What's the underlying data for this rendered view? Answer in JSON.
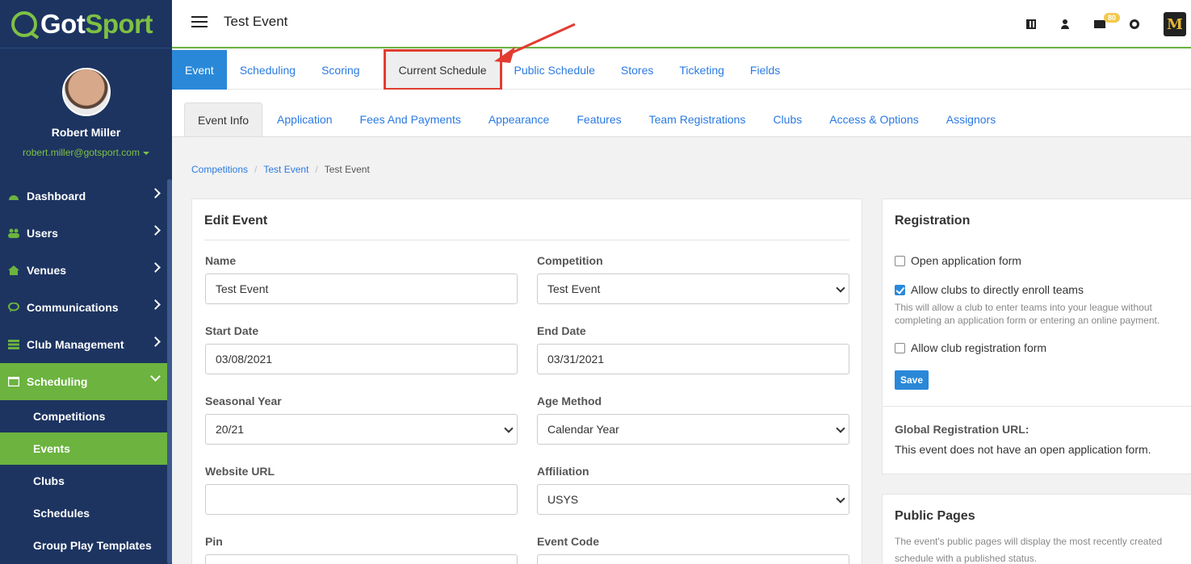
{
  "brand": {
    "name_a": "Got",
    "name_b": "Sport"
  },
  "profile": {
    "name": "Robert Miller",
    "email": "robert.miller@gotsport.com"
  },
  "sidebar": {
    "items": [
      {
        "label": "Dashboard"
      },
      {
        "label": "Users"
      },
      {
        "label": "Venues"
      },
      {
        "label": "Communications"
      },
      {
        "label": "Club Management"
      },
      {
        "label": "Scheduling"
      }
    ],
    "sub_items": [
      {
        "label": "Competitions"
      },
      {
        "label": "Events"
      },
      {
        "label": "Clubs"
      },
      {
        "label": "Schedules"
      },
      {
        "label": "Group Play Templates"
      }
    ]
  },
  "header": {
    "title": "Test Event",
    "mail_count": "80",
    "team_logo_letter": "M"
  },
  "primary_tabs": [
    "Event",
    "Scheduling",
    "Scoring",
    "Current Schedule",
    "Public Schedule",
    "Stores",
    "Ticketing",
    "Fields"
  ],
  "secondary_tabs": [
    "Event Info",
    "Application",
    "Fees And Payments",
    "Appearance",
    "Features",
    "Team Registrations",
    "Clubs",
    "Access & Options",
    "Assignors"
  ],
  "breadcrumb": [
    "Competitions",
    "Test Event",
    "Test Event"
  ],
  "edit_event": {
    "title": "Edit Event",
    "name": {
      "label": "Name",
      "value": "Test Event"
    },
    "competition": {
      "label": "Competition",
      "value": "Test Event"
    },
    "start_date": {
      "label": "Start Date",
      "value": "03/08/2021"
    },
    "end_date": {
      "label": "End Date",
      "value": "03/31/2021"
    },
    "seasonal_year": {
      "label": "Seasonal Year",
      "value": "20/21"
    },
    "age_method": {
      "label": "Age Method",
      "value": "Calendar Year"
    },
    "website_url": {
      "label": "Website URL",
      "value": ""
    },
    "affiliation": {
      "label": "Affiliation",
      "value": "USYS"
    },
    "pin": {
      "label": "Pin",
      "value": ""
    },
    "event_code": {
      "label": "Event Code",
      "value": ""
    }
  },
  "registration": {
    "title": "Registration",
    "open_application": {
      "label": "Open application form",
      "checked": false
    },
    "allow_enroll": {
      "label": "Allow clubs to directly enroll teams",
      "checked": true
    },
    "allow_enroll_help": "This will allow a club to enter teams into your league without completing an application form or entering an online payment.",
    "allow_club_reg": {
      "label": "Allow club registration form",
      "checked": false
    },
    "save_label": "Save",
    "global_url_title": "Global Registration URL:",
    "global_url_text": "This event does not have an open application form."
  },
  "public_pages": {
    "title": "Public Pages",
    "text": "The event's public pages will display the most recently created schedule with a published status."
  },
  "colors": {
    "sidebar": "#1d3461",
    "accent_green": "#6cb33f",
    "link_blue": "#2a7ae2",
    "highlight_red": "#e23c31"
  }
}
